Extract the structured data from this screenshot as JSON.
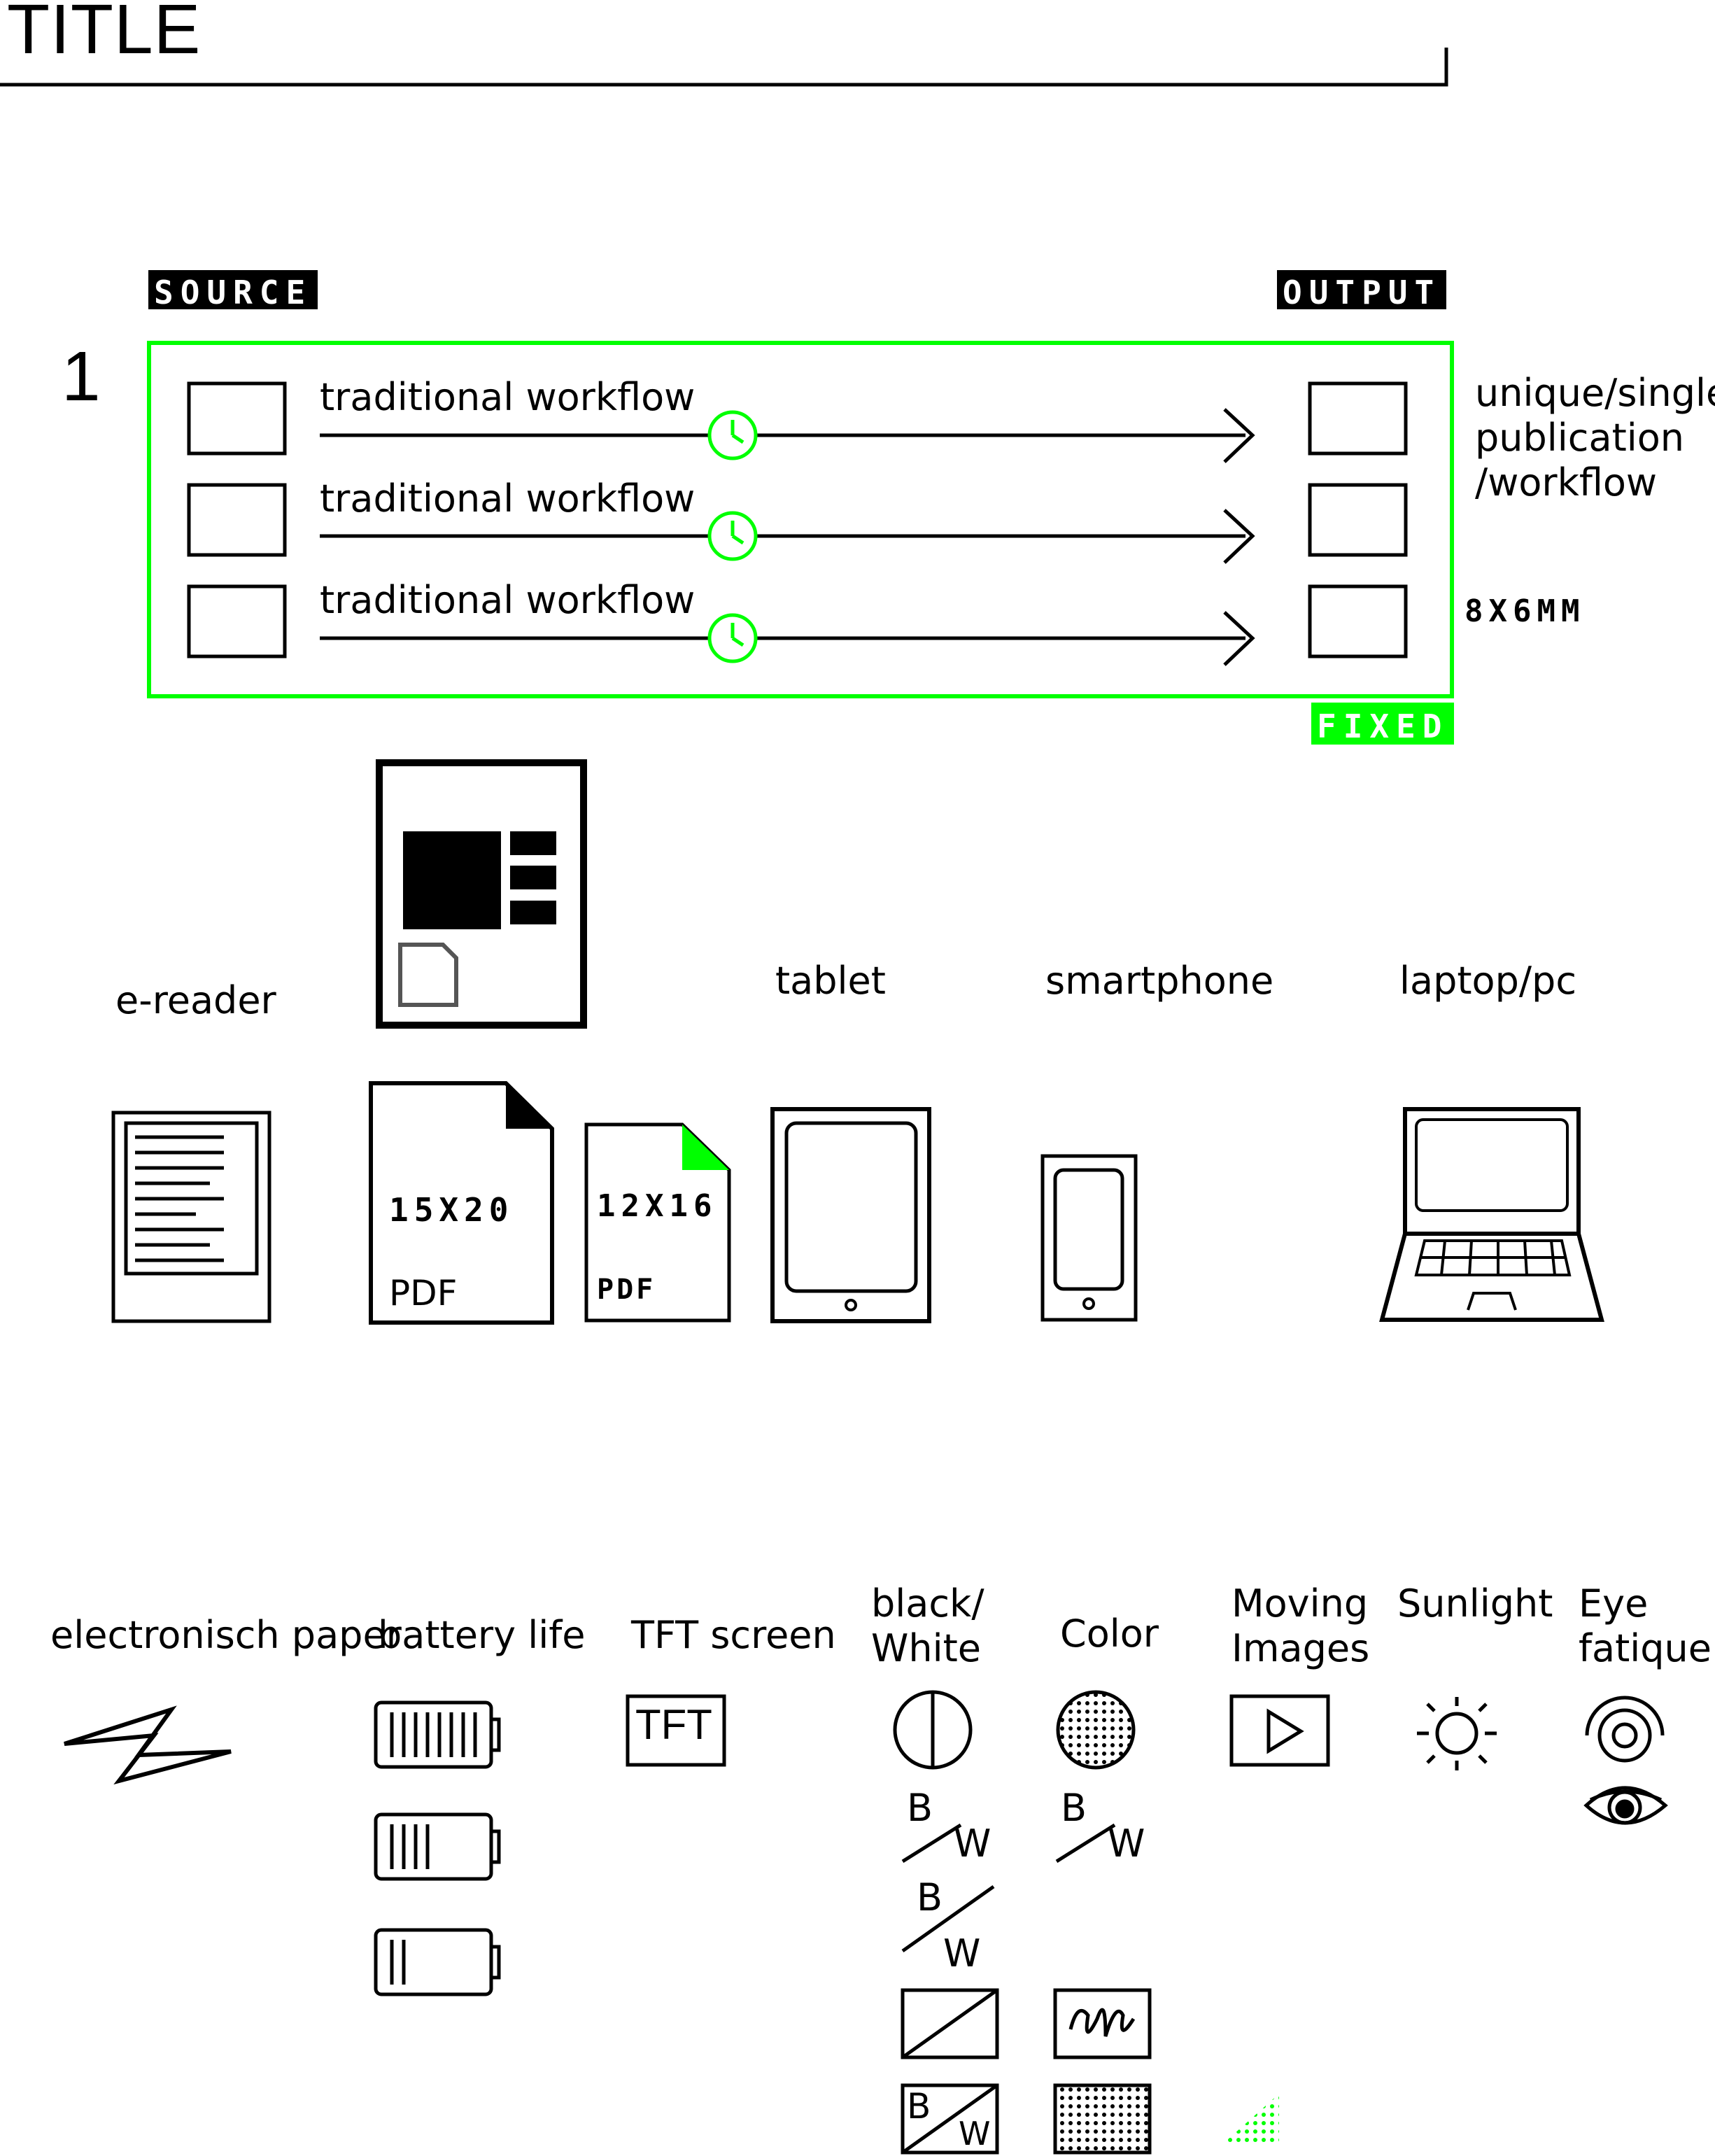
{
  "header": {
    "title": "TITLE"
  },
  "workflow": {
    "number": "1",
    "source_label": "SOURCE",
    "output_label": "OUTPUT",
    "fixed_label": "FIXED",
    "rows": [
      {
        "label": "traditional workflow"
      },
      {
        "label": "traditional workflow"
      },
      {
        "label": "traditional workflow"
      }
    ],
    "output_note": [
      "unique/single",
      "publication",
      "/workflow"
    ],
    "dimension": "8X6MM",
    "accent_color": "#00ff00"
  },
  "devices": {
    "labels": {
      "ereader": "e-reader",
      "tablet": "tablet",
      "smartphone": "smartphone",
      "laptop": "laptop/pc"
    },
    "pdf_large": {
      "size": "15X20",
      "format": "PDF"
    },
    "pdf_small": {
      "size": "12X16",
      "format": "PDF"
    }
  },
  "features": {
    "electronic_paper": "electronisch paper",
    "battery_life": "battery life",
    "tft_screen": "TFT screen",
    "tft_icon_text": "TFT",
    "black_white": [
      "black/",
      "White"
    ],
    "color": "Color",
    "moving_images": [
      "Moving",
      "Images"
    ],
    "sunlight": "Sunlight",
    "eye_fatigue": [
      "Eye",
      "fatique"
    ],
    "bw_letters": {
      "b": "B",
      "w": "W"
    }
  }
}
